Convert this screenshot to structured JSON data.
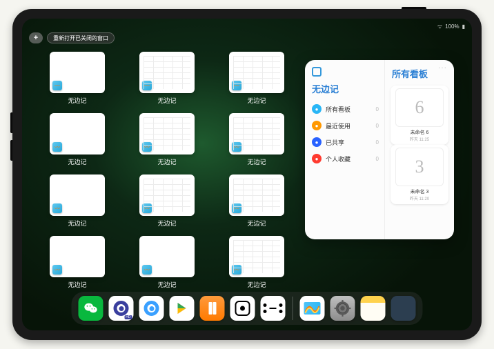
{
  "statusbar": {
    "battery": "100%",
    "wifi": "wifi"
  },
  "controls": {
    "plus": "+",
    "reopen_label": "重新打开已关闭的窗口"
  },
  "app_label": "无边记",
  "thumbnails": [
    {
      "label": "无边记",
      "variant": "blank"
    },
    {
      "label": "无边记",
      "variant": "grid"
    },
    {
      "label": "无边记",
      "variant": "grid"
    },
    {
      "label": "无边记",
      "variant": "blank"
    },
    {
      "label": "无边记",
      "variant": "grid"
    },
    {
      "label": "无边记",
      "variant": "grid"
    },
    {
      "label": "无边记",
      "variant": "blank"
    },
    {
      "label": "无边记",
      "variant": "grid"
    },
    {
      "label": "无边记",
      "variant": "grid"
    },
    {
      "label": "无边记",
      "variant": "blank"
    },
    {
      "label": "无边记",
      "variant": "blank"
    },
    {
      "label": "无边记",
      "variant": "grid"
    }
  ],
  "popover": {
    "title_left": "无边记",
    "title_right": "所有看板",
    "ellipsis": "···",
    "items": [
      {
        "label": "所有看板",
        "count": "0",
        "color": "#29b6f6"
      },
      {
        "label": "最近使用",
        "count": "0",
        "color": "#ff9800"
      },
      {
        "label": "已共享",
        "count": "0",
        "color": "#2962ff"
      },
      {
        "label": "个人收藏",
        "count": "0",
        "color": "#ff3b30"
      }
    ],
    "boards": [
      {
        "glyph": "6",
        "name": "未命名 6",
        "sub": "昨天 11:25"
      },
      {
        "glyph": "3",
        "name": "未命名 3",
        "sub": "昨天 11:20"
      }
    ]
  },
  "dock": {
    "apps": [
      {
        "id": "wechat",
        "name": "微信"
      },
      {
        "id": "quark-hd",
        "name": "夸克HD"
      },
      {
        "id": "quark",
        "name": "夸克"
      },
      {
        "id": "play",
        "name": "应用商店"
      },
      {
        "id": "books",
        "name": "图书"
      },
      {
        "id": "dice",
        "name": "App"
      },
      {
        "id": "connect",
        "name": "App"
      },
      {
        "id": "freeform",
        "name": "无边记"
      },
      {
        "id": "settings",
        "name": "设置"
      },
      {
        "id": "notes",
        "name": "备忘录"
      }
    ],
    "app_library": "资源库"
  }
}
